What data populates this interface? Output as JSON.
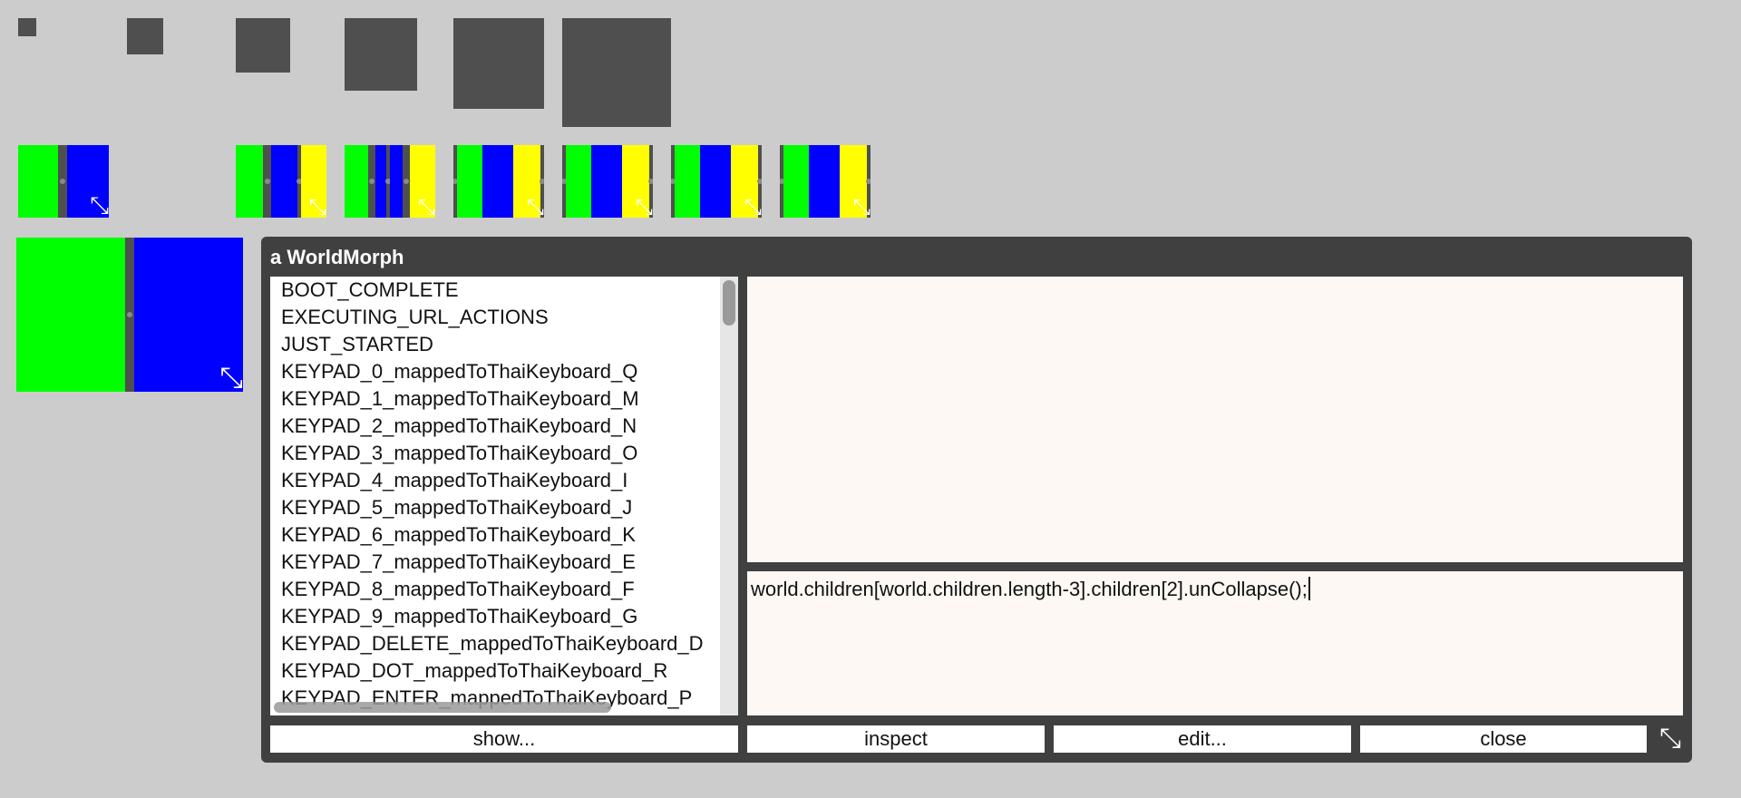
{
  "inspector": {
    "title": "a WorldMorph",
    "list_items": [
      "BOOT_COMPLETE",
      "EXECUTING_URL_ACTIONS",
      "JUST_STARTED",
      "KEYPAD_0_mappedToThaiKeyboard_Q",
      "KEYPAD_1_mappedToThaiKeyboard_M",
      "KEYPAD_2_mappedToThaiKeyboard_N",
      "KEYPAD_3_mappedToThaiKeyboard_O",
      "KEYPAD_4_mappedToThaiKeyboard_I",
      "KEYPAD_5_mappedToThaiKeyboard_J",
      "KEYPAD_6_mappedToThaiKeyboard_K",
      "KEYPAD_7_mappedToThaiKeyboard_E",
      "KEYPAD_8_mappedToThaiKeyboard_F",
      "KEYPAD_9_mappedToThaiKeyboard_G",
      "KEYPAD_DELETE_mappedToThaiKeyboard_D",
      "KEYPAD_DOT_mappedToThaiKeyboard_R",
      "KEYPAD_ENTER_mappedToThaiKeyboard_P"
    ],
    "eval_text": "world.children[world.children.length-3].children[2].unCollapse();",
    "buttons": {
      "show": "show...",
      "inspect": "inspect",
      "edit": "edit...",
      "close": "close"
    }
  },
  "icons": {
    "resize_handle": "resize-handle-icon",
    "resize_glyph": "⤡"
  },
  "colors": {
    "background": "#cccccc",
    "square": "#4f4f4f",
    "green": "#00ff00",
    "blue": "#0000ff",
    "yellow": "#ffff00",
    "window": "#404040",
    "pane": "#fdf8f3"
  }
}
